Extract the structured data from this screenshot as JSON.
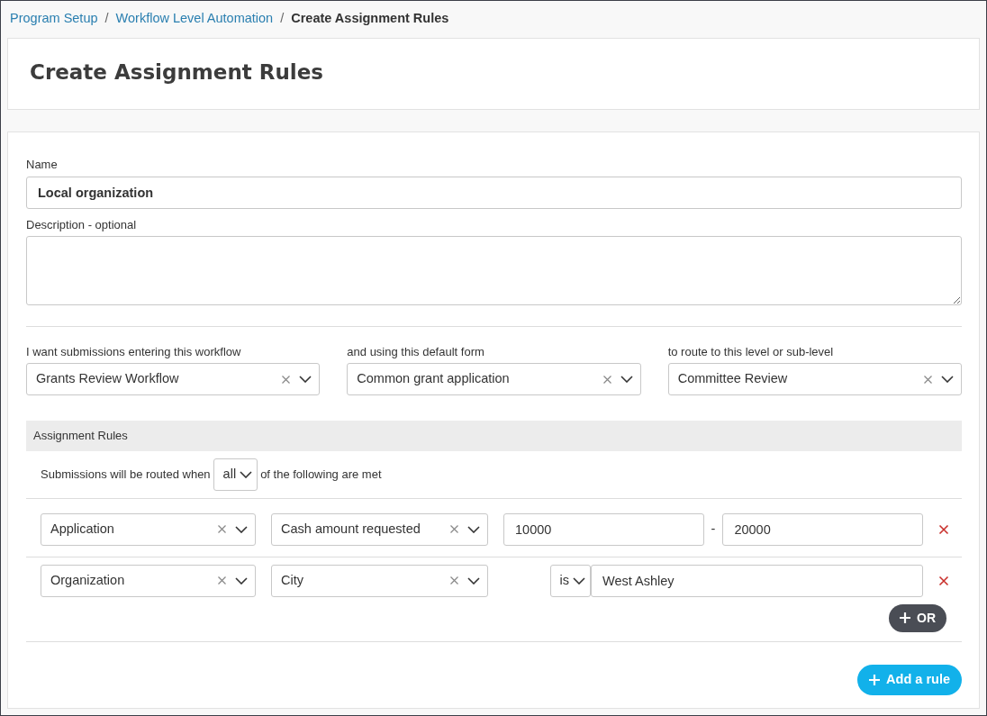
{
  "breadcrumb": [
    {
      "label": "Program Setup",
      "kind": "link"
    },
    {
      "label": "/",
      "kind": "separator"
    },
    {
      "label": "Workflow Level Automation",
      "kind": "link"
    },
    {
      "label": "/",
      "kind": "separator"
    },
    {
      "label": "Create Assignment Rules",
      "kind": "current"
    }
  ],
  "page_title": "Create Assignment Rules",
  "name_field": {
    "label": "Name",
    "value": "Local organization"
  },
  "description_field": {
    "label": "Description - optional"
  },
  "routing": [
    {
      "label": "I want submissions entering this workflow",
      "value": "Grants Review Workflow"
    },
    {
      "label": "and using this default form",
      "value": "Common grant application"
    },
    {
      "label": "to route to this level or sub-level",
      "value": "Committee Review"
    }
  ],
  "assignment_rules": {
    "title": "Assignment Rules",
    "condition_prefix": "Submissions will be routed when",
    "match": "all",
    "condition_suffix": "of the following are met",
    "rules": [
      {
        "kind": "range",
        "source": "Application",
        "field": "Cash amount requested",
        "from": "10000",
        "separator": "-",
        "to": "20000"
      },
      {
        "kind": "comparison",
        "source": "Organization",
        "field": "City",
        "operator": "is",
        "value": "West Ashley"
      }
    ],
    "or_button": "OR",
    "add_button": "Add a rule"
  }
}
